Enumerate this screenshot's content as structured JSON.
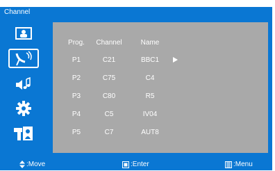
{
  "window": {
    "title": "Channel"
  },
  "sidebar": {
    "items": [
      {
        "icon": "picture-icon"
      },
      {
        "icon": "antenna-icon",
        "selected": true
      },
      {
        "icon": "sound-icon"
      },
      {
        "icon": "setup-icon"
      },
      {
        "icon": "input-icon"
      }
    ]
  },
  "table": {
    "headers": [
      "Prog.",
      "Channel",
      "Name"
    ],
    "rows": [
      {
        "prog": "P1",
        "channel": "C21",
        "name": "BBC1",
        "selected": true
      },
      {
        "prog": "P2",
        "channel": "C75",
        "name": "C4"
      },
      {
        "prog": "P3",
        "channel": "C80",
        "name": "R5"
      },
      {
        "prog": "P4",
        "channel": "C5",
        "name": "IV04"
      },
      {
        "prog": "P5",
        "channel": "C7",
        "name": "AUT8"
      }
    ]
  },
  "footer": {
    "move": ":Move",
    "enter": ":Enter",
    "menu": ":Menu"
  },
  "colors": {
    "accent": "#0a77d3",
    "panel": "#a9a9a9",
    "text": "#ffffff"
  }
}
